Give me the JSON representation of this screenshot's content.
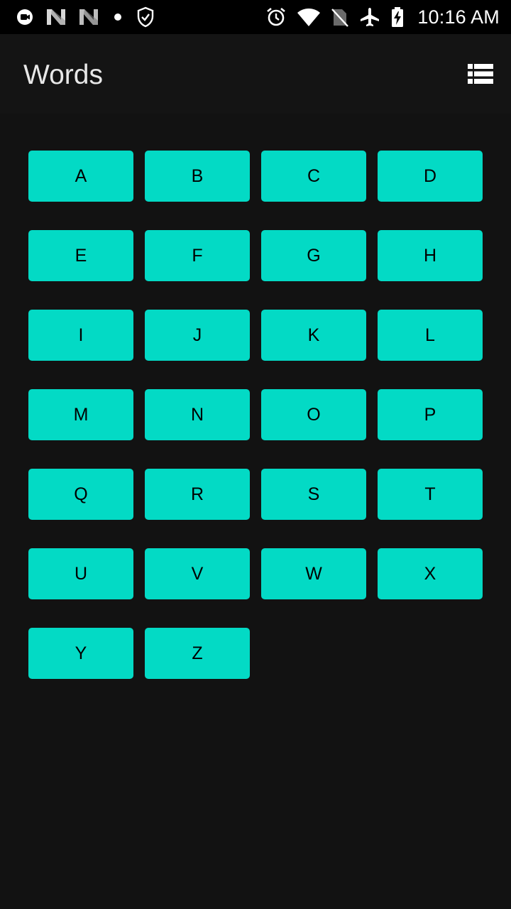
{
  "status_bar": {
    "time": "10:16 AM",
    "left_icons": [
      "screen-record-icon",
      "n-logo-icon",
      "n-logo-icon",
      "dot-icon",
      "shield-check-icon"
    ],
    "right_icons": [
      "alarm-icon",
      "wifi-icon",
      "no-sim-icon",
      "airplane-mode-icon",
      "battery-charging-icon"
    ]
  },
  "app_bar": {
    "title": "Words",
    "view_toggle_icon": "list-view-icon"
  },
  "letters": [
    "A",
    "B",
    "C",
    "D",
    "E",
    "F",
    "G",
    "H",
    "I",
    "J",
    "K",
    "L",
    "M",
    "N",
    "O",
    "P",
    "Q",
    "R",
    "S",
    "T",
    "U",
    "V",
    "W",
    "X",
    "Y",
    "Z"
  ],
  "colors": {
    "background": "#121212",
    "button": "#03dac5",
    "button_text": "#000000",
    "title_text": "#e8e8e8"
  }
}
